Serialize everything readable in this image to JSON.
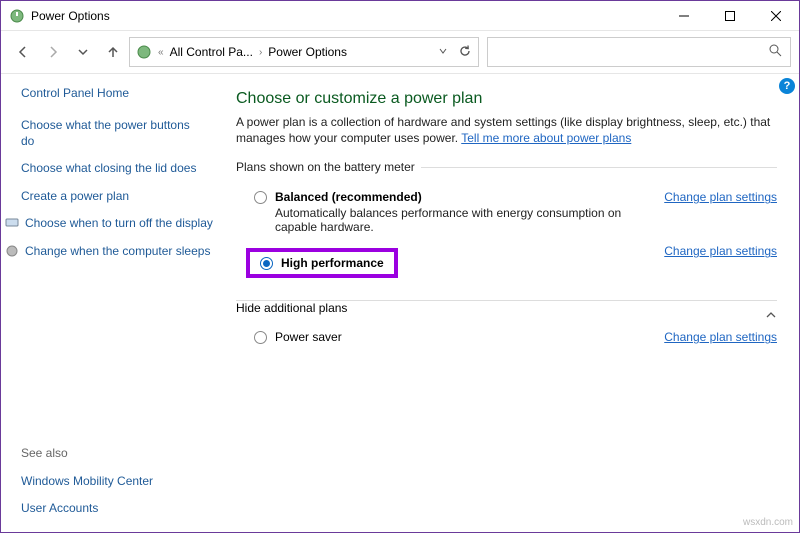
{
  "window": {
    "title": "Power Options"
  },
  "breadcrumb": {
    "level1": "All Control Pa...",
    "level2": "Power Options"
  },
  "sidebar": {
    "home": "Control Panel Home",
    "links": [
      "Choose what the power buttons do",
      "Choose what closing the lid does",
      "Create a power plan",
      "Choose when to turn off the display",
      "Change when the computer sleeps"
    ],
    "seealso": "See also",
    "seeitems": [
      "Windows Mobility Center",
      "User Accounts"
    ]
  },
  "main": {
    "heading": "Choose or customize a power plan",
    "desc_pre": "A power plan is a collection of hardware and system settings (like display brightness, sleep, etc.) that manages how your computer uses power. ",
    "desc_link": "Tell me more about power plans",
    "group1": "Plans shown on the battery meter",
    "group2": "Hide additional plans",
    "change": "Change plan settings",
    "plans": {
      "balanced": {
        "title": "Balanced (recommended)",
        "desc": "Automatically balances performance with energy consumption on capable hardware."
      },
      "high": {
        "title": "High performance"
      },
      "saver": {
        "title": "Power saver"
      }
    }
  },
  "watermark": "wsxdn.com"
}
